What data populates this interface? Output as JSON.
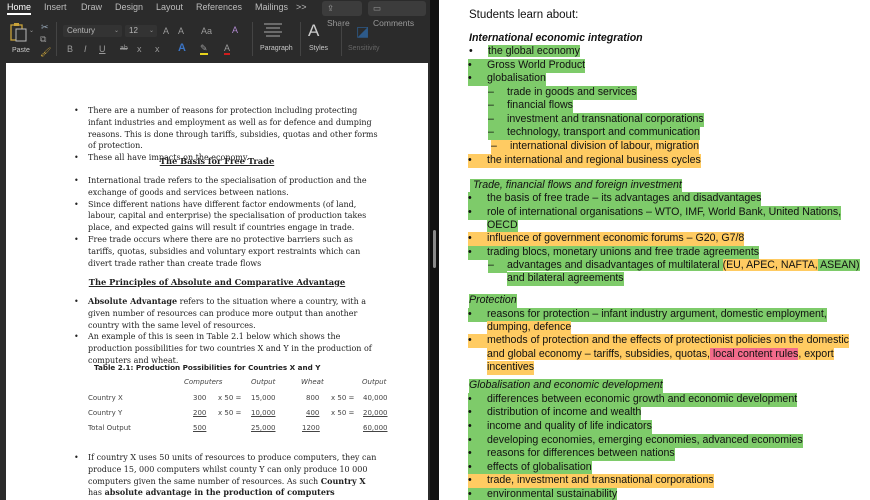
{
  "word": {
    "tabs": [
      "Home",
      "Insert",
      "Draw",
      "Design",
      "Layout",
      "References",
      "Mailings",
      ">>"
    ],
    "active_tab": "Home",
    "share_label": "Share",
    "comments_label": "Comments",
    "ribbon": {
      "paste_label": "Paste",
      "font_name": "Century",
      "font_size": "12",
      "paragraph_label": "Paragraph",
      "styles_label": "Styles",
      "sensitivity_label": "Sensitivity",
      "icons": {
        "bold": "B",
        "italic": "I",
        "underline": "U",
        "strikethrough": "ab",
        "subscript": "x",
        "superscript": "x",
        "grow": "A",
        "shrink": "A",
        "change_case": "Aa",
        "clear_format": "A",
        "text_effects": "A",
        "highlight": "✎",
        "font_color": "A"
      },
      "colors": {
        "highlight": "#e7d21b",
        "font_color": "#d01c1c",
        "text_effects": "#3b74c4",
        "paste": "#c8a23a"
      }
    },
    "document": {
      "bullets_1": [
        "There are a number of reasons for protection including protecting infant industries and employment as well as for defence and dumping reasons. This is done through tariffs, subsidies, quotas and other forms of protection.",
        "These all have impacts on the economy."
      ],
      "heading_1": "The Basis for Free Trade",
      "bullets_2": [
        "International trade refers to the specialisation of production and the exchange of goods and services between nations.",
        "Since different nations have different factor endowments (of land, labour, capital and enterprise) the specialisation of production takes place, and expected gains will result if countries engage in trade.",
        "Free trade occurs where there are no protective barriers such as tariffs, quotas, subsidies and voluntary export restraints which can divert trade rather than create trade flows"
      ],
      "heading_2": "The Principles of Absolute and Comparative Advantage",
      "absolute_bold": "Absolute Advantage",
      "absolute_rest": " refers to the situation where a country, with a given number of resources can produce more output than another country with the same level of resources.",
      "example": "An example of this is seen in Table 2.1 below which shows the production possibilities for two countries X and Y in the production of computers and wheat.",
      "table": {
        "title": "Table 2.1: Production Possibilities for Countries X and Y",
        "headers": [
          "Computers",
          "Output",
          "Wheat",
          "Output"
        ],
        "rows": [
          {
            "label": "Country X",
            "computers": "300",
            "mult1": "x 50 =",
            "output1": "15,000",
            "wheat": "800",
            "mult2": "x 50 =",
            "output2": "40,000"
          },
          {
            "label": "Country Y",
            "computers": "200",
            "mult1": "x 50 =",
            "output1": "10,000",
            "wheat": "400",
            "mult2": "x 50 =",
            "output2": "20,000"
          },
          {
            "label": "Total Output",
            "computers": "500",
            "mult1": "",
            "output1": "25,000",
            "wheat": "1200",
            "mult2": "",
            "output2": "60,000"
          }
        ]
      },
      "last_bullet_text": "If country X uses 50 units of resources to produce computers, they can produce 15, 000 computers whilst county Y can only produce 10 000 computers given the same number of resources. As such ",
      "last_bullet_bold1": "Country X",
      "last_bullet_mid": " has ",
      "last_bullet_bold2": "absolute advantage in the production of computers"
    }
  },
  "syllabus": {
    "intro": "Students learn about:",
    "highlight_colors": {
      "green": "#7ecb6a",
      "orange": "#ffcb62",
      "pink": "#f36b8b"
    },
    "section_1": {
      "title": "International economic integration",
      "items": [
        "the global economy",
        "Gross World Product",
        "globalisation",
        "trade in goods and services",
        "financial flows",
        "investment and transnational corporations",
        "technology, transport and communication",
        "international division of labour, migration",
        "the international and regional business cycles"
      ]
    },
    "section_2": {
      "title": "Trade, financial flows and foreign investment",
      "items": [
        "the basis of free trade – its advantages and disadvantages",
        "role of international organisations – WTO, IMF, World Bank, United Nations,",
        "OECD",
        "influence of government economic forums – G20, G7/8",
        "trading blocs, monetary unions and free trade agreements",
        "advantages and disadvantages of multilateral ",
        "(EU, APEC, NAFTA,",
        " ASEAN)",
        "and bilateral agreements"
      ]
    },
    "section_3": {
      "title": "Protection",
      "items": [
        "reasons for protection – infant industry argument, domestic employment,",
        "dumping, defence",
        "methods of protection and the effects of protectionist policies on the domestic",
        "and global economy – tariffs, subsidies, quotas,",
        " local content rules",
        ", export",
        "incentives"
      ]
    },
    "section_4": {
      "title": "Globalisation and economic development",
      "items": [
        "differences between economic growth and economic development",
        "distribution of income and wealth",
        "income and quality of life indicators",
        "developing economies, emerging economies, advanced economies",
        "reasons for differences between nations",
        "effects of globalisation",
        "trade, investment and transnational corporations",
        "environmental sustainability"
      ]
    },
    "bullet": "•",
    "dash": "–"
  }
}
